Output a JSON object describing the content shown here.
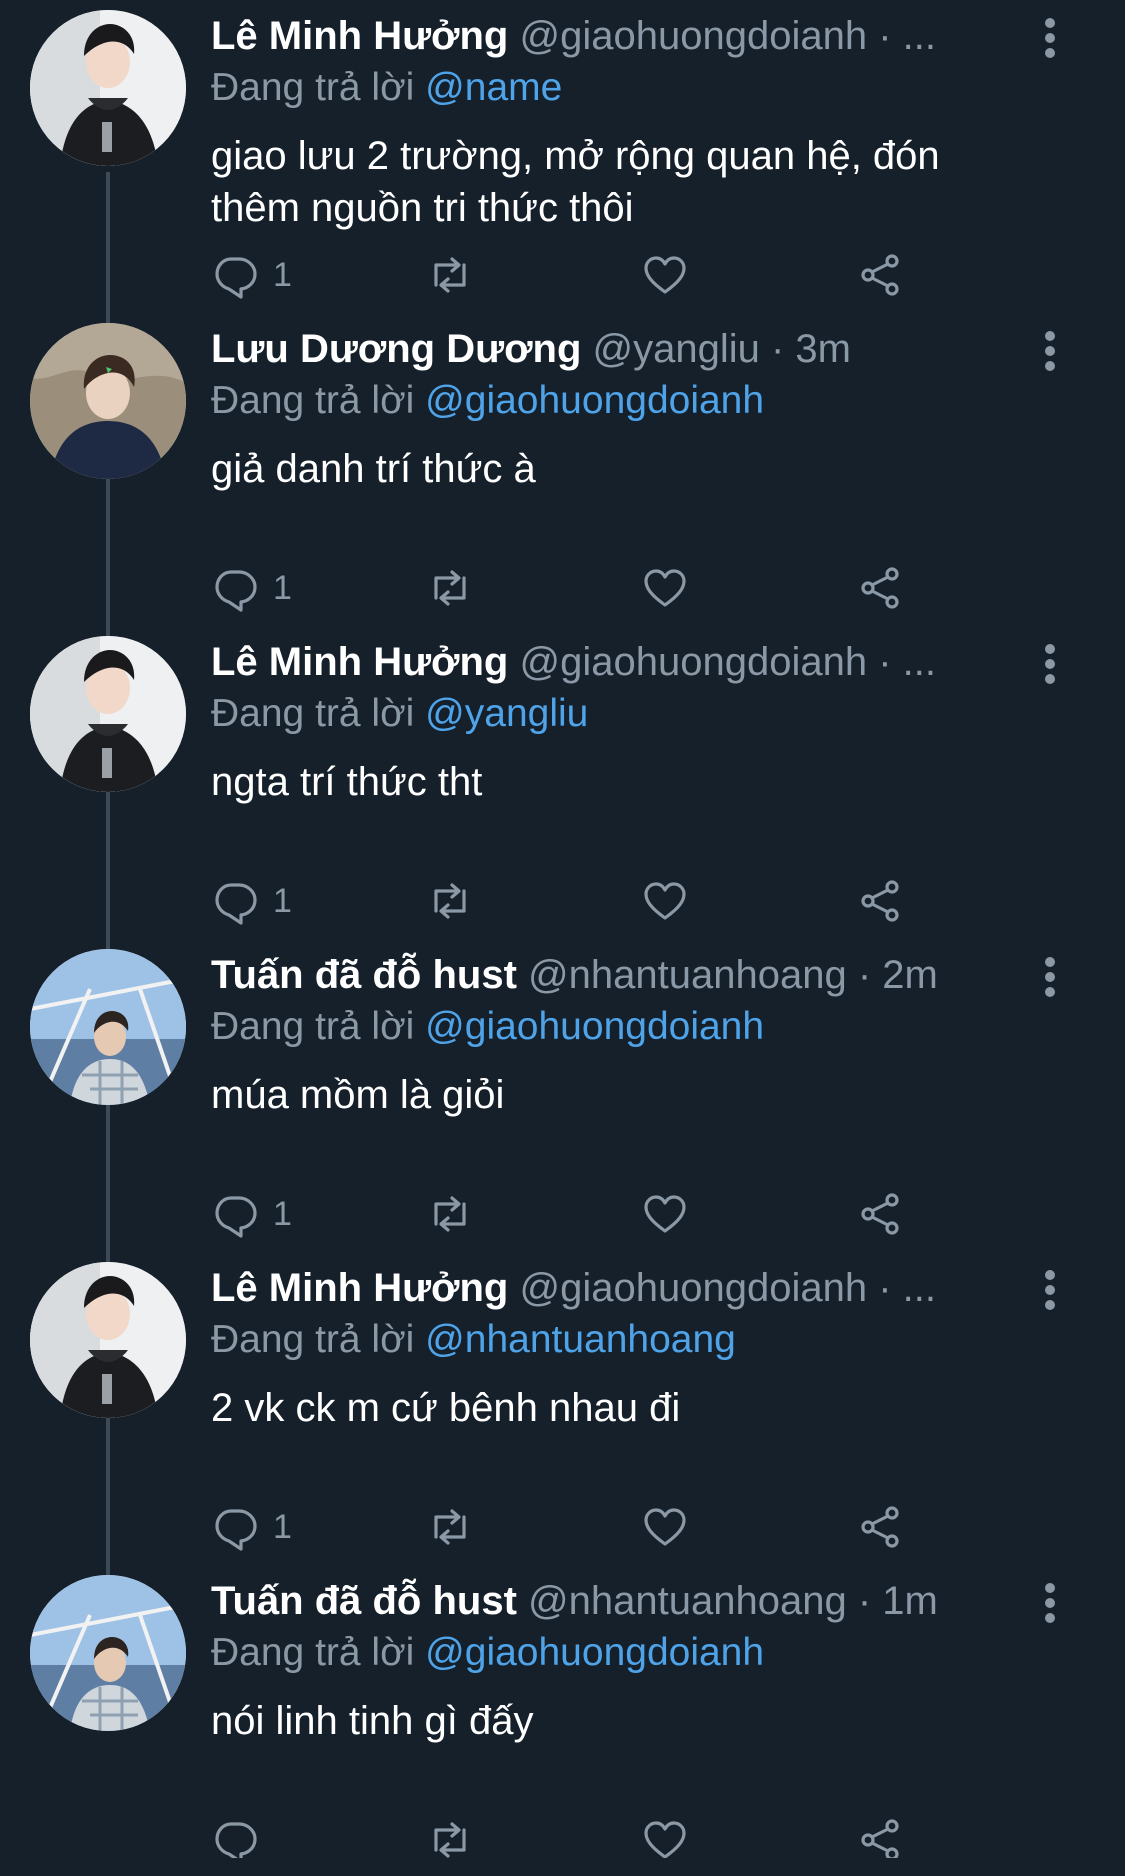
{
  "reply_prefix": "Đang trả lời",
  "colors": {
    "background": "#15202b",
    "muted": "#8b98a5",
    "link": "#4fa3e8",
    "thread_line": "#3d4a57"
  },
  "tweets": [
    {
      "name": "Lê Minh Hưởng",
      "meta": "@giaohuongdoianh · ...",
      "mention": "@name",
      "text": "giao lưu 2 trường, mở rộng quan hệ, đón thêm nguồn tri thức thôi",
      "reply_count": "1",
      "avatar": "dark-hoodie-avatar"
    },
    {
      "name": "Lưu Dương Dương",
      "meta": "@yangliu · 3m",
      "mention": "@giaohuongdoianh",
      "text": "giả danh trí thức à",
      "reply_count": "1",
      "avatar": "navy-hoodie-avatar"
    },
    {
      "name": "Lê Minh Hưởng",
      "meta": "@giaohuongdoianh · ...",
      "mention": "@yangliu",
      "text": "ngta trí thức tht",
      "reply_count": "1",
      "avatar": "dark-hoodie-avatar"
    },
    {
      "name": "Tuấn đã đỗ hust",
      "meta": "@nhantuanhoang · 2m",
      "mention": "@giaohuongdoianh",
      "text": "múa mồm là giỏi",
      "reply_count": "1",
      "avatar": "boat-avatar"
    },
    {
      "name": "Lê Minh Hưởng",
      "meta": "@giaohuongdoianh · ...",
      "mention": "@nhantuanhoang",
      "text": "2 vk ck m cứ bênh nhau đi",
      "reply_count": "1",
      "avatar": "dark-hoodie-avatar"
    },
    {
      "name": "Tuấn đã đỗ hust",
      "meta": "@nhantuanhoang · 1m",
      "mention": "@giaohuongdoianh",
      "text": "nói linh tinh gì đấy",
      "reply_count": "",
      "avatar": "boat-avatar"
    }
  ]
}
